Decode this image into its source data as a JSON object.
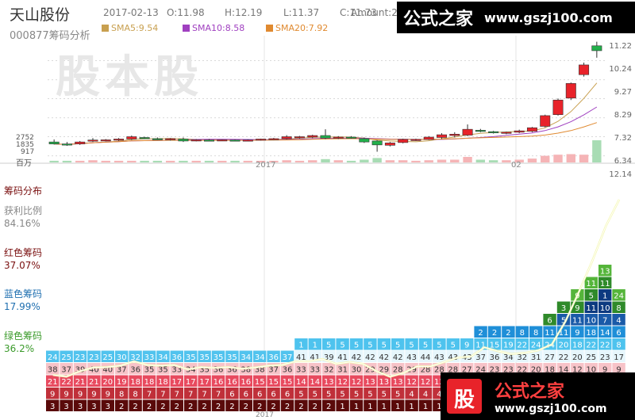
{
  "header": {
    "name": "天山股份",
    "code_title": "000877筹码分析",
    "date": "2017-02-13",
    "open": "O:11.98",
    "high": "H:12.19",
    "low": "L:11.37",
    "close": "C:11.73",
    "amount": "Amount:2"
  },
  "ma_legend": [
    {
      "label": "SMA5:9.54",
      "color": "#c8a050"
    },
    {
      "label": "SMA10:8.58",
      "color": "#a040c0"
    },
    {
      "label": "SMA20:7.92",
      "color": "#e08a30"
    }
  ],
  "watermark": {
    "text": "股本股",
    "logo_char": "股"
  },
  "brand": {
    "top_title": "公式之家",
    "top_url": "www.gszj100.com",
    "bottom_title": "公式之家",
    "bottom_url": "www.gszj100.com"
  },
  "price_axis": {
    "labels": [
      "11.22",
      "10.24",
      "9.27",
      "8.29",
      "7.32",
      "6.34"
    ],
    "values": [
      11.22,
      10.24,
      9.27,
      8.29,
      7.32,
      6.34
    ]
  },
  "volume_axis": {
    "labels": [
      "2752",
      "1835",
      "917",
      "百万"
    ]
  },
  "x_labels": [
    {
      "text": "2017",
      "x": 333
    },
    {
      "text": "02",
      "x": 650
    }
  ],
  "bottom_x_label": "2017",
  "chip_axis_top": "12.14",
  "sidebar": {
    "title": "筹码分布",
    "profit_label": "获利比例",
    "profit_value": "84.16%",
    "red_label": "红色筹码",
    "red_value": "37.07%",
    "blue_label": "蓝色筹码",
    "blue_value": "17.99%",
    "green_label": "绿色筹码",
    "green_value": "36.2%"
  },
  "colors": {
    "up": "#e8232a",
    "down": "#22b04b",
    "grid": "#d9d9d9"
  },
  "chart_data": {
    "type": "candlestick",
    "title": "",
    "ylim": [
      6.0,
      12.5
    ],
    "candles": [
      {
        "o": 7.05,
        "h": 7.18,
        "l": 6.92,
        "c": 6.95
      },
      {
        "o": 6.95,
        "h": 7.05,
        "l": 6.85,
        "c": 6.9
      },
      {
        "o": 6.95,
        "h": 7.1,
        "l": 6.9,
        "c": 7.05
      },
      {
        "o": 7.1,
        "h": 7.25,
        "l": 7.05,
        "c": 7.15
      },
      {
        "o": 7.12,
        "h": 7.2,
        "l": 7.08,
        "c": 7.16
      },
      {
        "o": 7.15,
        "h": 7.25,
        "l": 7.1,
        "c": 7.2
      },
      {
        "o": 7.2,
        "h": 7.38,
        "l": 7.15,
        "c": 7.32
      },
      {
        "o": 7.28,
        "h": 7.32,
        "l": 7.2,
        "c": 7.22
      },
      {
        "o": 7.22,
        "h": 7.28,
        "l": 7.15,
        "c": 7.2
      },
      {
        "o": 7.18,
        "h": 7.25,
        "l": 7.12,
        "c": 7.22
      },
      {
        "o": 7.2,
        "h": 7.28,
        "l": 7.05,
        "c": 7.1
      },
      {
        "o": 7.12,
        "h": 7.2,
        "l": 7.08,
        "c": 7.16
      },
      {
        "o": 7.15,
        "h": 7.2,
        "l": 7.12,
        "c": 7.14
      },
      {
        "o": 7.14,
        "h": 7.18,
        "l": 7.1,
        "c": 7.16
      },
      {
        "o": 7.15,
        "h": 7.18,
        "l": 7.1,
        "c": 7.12
      },
      {
        "o": 7.12,
        "h": 7.18,
        "l": 7.08,
        "c": 7.15
      },
      {
        "o": 7.15,
        "h": 7.22,
        "l": 7.12,
        "c": 7.2
      },
      {
        "o": 7.18,
        "h": 7.26,
        "l": 7.15,
        "c": 7.22
      },
      {
        "o": 7.22,
        "h": 7.4,
        "l": 7.18,
        "c": 7.32
      },
      {
        "o": 7.28,
        "h": 7.36,
        "l": 7.22,
        "c": 7.32
      },
      {
        "o": 7.3,
        "h": 7.42,
        "l": 7.25,
        "c": 7.38
      },
      {
        "o": 7.38,
        "h": 7.7,
        "l": 7.2,
        "c": 7.25
      },
      {
        "o": 7.28,
        "h": 7.35,
        "l": 7.2,
        "c": 7.3
      },
      {
        "o": 7.3,
        "h": 7.35,
        "l": 7.22,
        "c": 7.25
      },
      {
        "o": 7.22,
        "h": 7.28,
        "l": 7.0,
        "c": 7.05
      },
      {
        "o": 7.1,
        "h": 7.15,
        "l": 6.55,
        "c": 6.9
      },
      {
        "o": 6.88,
        "h": 7.05,
        "l": 6.82,
        "c": 7.0
      },
      {
        "o": 7.02,
        "h": 7.22,
        "l": 6.98,
        "c": 7.18
      },
      {
        "o": 7.15,
        "h": 7.22,
        "l": 7.1,
        "c": 7.18
      },
      {
        "o": 7.18,
        "h": 7.35,
        "l": 7.15,
        "c": 7.3
      },
      {
        "o": 7.28,
        "h": 7.5,
        "l": 7.2,
        "c": 7.42
      },
      {
        "o": 7.38,
        "h": 7.55,
        "l": 7.28,
        "c": 7.45
      },
      {
        "o": 7.4,
        "h": 7.95,
        "l": 7.35,
        "c": 7.7
      },
      {
        "o": 7.65,
        "h": 7.72,
        "l": 7.55,
        "c": 7.6
      },
      {
        "o": 7.58,
        "h": 7.62,
        "l": 7.48,
        "c": 7.52
      },
      {
        "o": 7.5,
        "h": 7.58,
        "l": 7.45,
        "c": 7.55
      },
      {
        "o": 7.55,
        "h": 7.68,
        "l": 7.5,
        "c": 7.62
      },
      {
        "o": 7.6,
        "h": 7.82,
        "l": 7.55,
        "c": 7.78
      },
      {
        "o": 7.85,
        "h": 8.45,
        "l": 7.8,
        "c": 8.4
      },
      {
        "o": 8.45,
        "h": 9.28,
        "l": 8.4,
        "c": 9.2
      },
      {
        "o": 9.3,
        "h": 10.1,
        "l": 9.2,
        "c": 10.05
      },
      {
        "o": 10.5,
        "h": 11.12,
        "l": 10.4,
        "c": 11.0
      },
      {
        "o": 11.98,
        "h": 12.19,
        "l": 11.37,
        "c": 11.73
      }
    ],
    "volume": [
      3,
      3,
      3,
      4,
      3,
      3,
      3,
      3,
      3,
      3,
      3,
      3,
      3,
      3,
      3,
      3,
      3,
      3,
      4,
      3,
      4,
      6,
      4,
      3,
      5,
      8,
      4,
      4,
      3,
      4,
      5,
      5,
      10,
      5,
      4,
      4,
      5,
      7,
      12,
      14,
      15,
      14,
      40
    ]
  },
  "chip_columns": [
    {
      "values": [
        "3",
        "9",
        "21",
        "38",
        "24"
      ],
      "blue": 1
    },
    {
      "values": [
        "3",
        "9",
        "22",
        "37",
        "25"
      ],
      "blue": 1
    },
    {
      "values": [
        "3",
        "9",
        "21",
        "39",
        "23"
      ],
      "blue": 1
    },
    {
      "values": [
        "3",
        "9",
        "21",
        "40",
        "23"
      ],
      "blue": 1
    },
    {
      "values": [
        "3",
        "9",
        "20",
        "40",
        "25"
      ],
      "blue": 1
    },
    {
      "values": [
        "2",
        "8",
        "19",
        "37",
        "30"
      ],
      "blue": 1
    },
    {
      "values": [
        "2",
        "8",
        "18",
        "36",
        "32"
      ],
      "blue": 1
    },
    {
      "values": [
        "2",
        "7",
        "18",
        "35",
        "33"
      ],
      "blue": 1
    },
    {
      "values": [
        "2",
        "7",
        "18",
        "35",
        "34"
      ],
      "blue": 1
    },
    {
      "values": [
        "2",
        "7",
        "17",
        "33",
        "36"
      ],
      "blue": 1
    },
    {
      "values": [
        "2",
        "7",
        "17",
        "34",
        "35"
      ],
      "blue": 1
    },
    {
      "values": [
        "2",
        "7",
        "17",
        "35",
        "35"
      ],
      "blue": 1
    },
    {
      "values": [
        "2",
        "7",
        "16",
        "36",
        "35"
      ],
      "blue": 1
    },
    {
      "values": [
        "2",
        "6",
        "16",
        "36",
        "35"
      ],
      "blue": 1
    },
    {
      "values": [
        "2",
        "6",
        "16",
        "38",
        "34"
      ],
      "blue": 1
    },
    {
      "values": [
        "2",
        "6",
        "15",
        "38",
        "34"
      ],
      "blue": 1
    },
    {
      "values": [
        "2",
        "6",
        "15",
        "37",
        "36"
      ],
      "blue": 1
    },
    {
      "values": [
        "2",
        "6",
        "15",
        "36",
        "37"
      ],
      "blue": 1
    },
    {
      "values": [
        "2",
        "5",
        "14",
        "33",
        "41",
        "1"
      ],
      "blue": 1
    },
    {
      "values": [
        "2",
        "5",
        "14",
        "33",
        "41",
        "1"
      ],
      "blue": 1
    },
    {
      "values": [
        "2",
        "5",
        "13",
        "32",
        "39",
        "5"
      ],
      "blue": 1
    },
    {
      "values": [
        "1",
        "5",
        "12",
        "31",
        "41",
        "5"
      ],
      "blue": 1
    },
    {
      "values": [
        "1",
        "5",
        "12",
        "30",
        "42",
        "5"
      ],
      "blue": 1
    },
    {
      "values": [
        "1",
        "5",
        "13",
        "29",
        "42",
        "5"
      ],
      "blue": 1
    },
    {
      "values": [
        "1",
        "5",
        "13",
        "29",
        "42",
        "5"
      ],
      "blue": 1
    },
    {
      "values": [
        "1",
        "5",
        "13",
        "28",
        "42",
        "5"
      ],
      "blue": 1
    },
    {
      "values": [
        "1",
        "4",
        "12",
        "29",
        "43",
        "5"
      ],
      "blue": 1
    },
    {
      "values": [
        "1",
        "4",
        "12",
        "28",
        "44",
        "5"
      ],
      "blue": 1
    },
    {
      "values": [
        "1",
        "4",
        "12",
        "28",
        "43",
        "5"
      ],
      "blue": 1
    },
    {
      "values": [
        "1",
        "4",
        "11",
        "28",
        "43",
        "5"
      ],
      "blue": 1
    },
    {
      "values": [
        "1",
        "4",
        "11",
        "27",
        "43",
        "9"
      ],
      "blue": 2
    },
    {
      "values": [
        "1",
        "4",
        "10",
        "24",
        "37",
        "11",
        "2"
      ],
      "blue": 2
    },
    {
      "values": [
        "1",
        "4",
        "10",
        "23",
        "36",
        "15",
        "2"
      ],
      "blue": 2
    },
    {
      "values": [
        "1",
        "4",
        "10",
        "23",
        "34",
        "19",
        "2"
      ],
      "blue": 2
    },
    {
      "values": [
        "1",
        "4",
        "9",
        "22",
        "32",
        "22",
        "8"
      ],
      "blue": 2
    },
    {
      "values": [
        "1",
        "4",
        "8",
        "20",
        "31",
        "24",
        "8"
      ],
      "blue": 2
    },
    {
      "values": [
        "1",
        "3",
        "8",
        "18",
        "27",
        "24",
        "11",
        "6"
      ],
      "blue": 2
    },
    {
      "values": [
        "1",
        "3",
        "7",
        "14",
        "22",
        "20",
        "11",
        "5",
        "3"
      ],
      "blue": 3
    },
    {
      "values": [
        "1",
        "3",
        "6",
        "12",
        "20",
        "18",
        "9",
        "11",
        "9",
        "9"
      ],
      "blue": 3
    },
    {
      "values": [
        "1",
        "2",
        "4",
        "10",
        "25",
        "22",
        "18",
        "10",
        "11",
        "5",
        "11"
      ],
      "blue": 4
    },
    {
      "values": [
        "1",
        "2",
        "5",
        "9",
        "23",
        "22",
        "14",
        "7",
        "10",
        "1",
        "11",
        "13"
      ],
      "blue": 5
    },
    {
      "values": [
        "1",
        "2",
        "4",
        "9",
        "17",
        "8",
        "6",
        "4",
        "8",
        "24"
      ],
      "blue": 3
    }
  ]
}
